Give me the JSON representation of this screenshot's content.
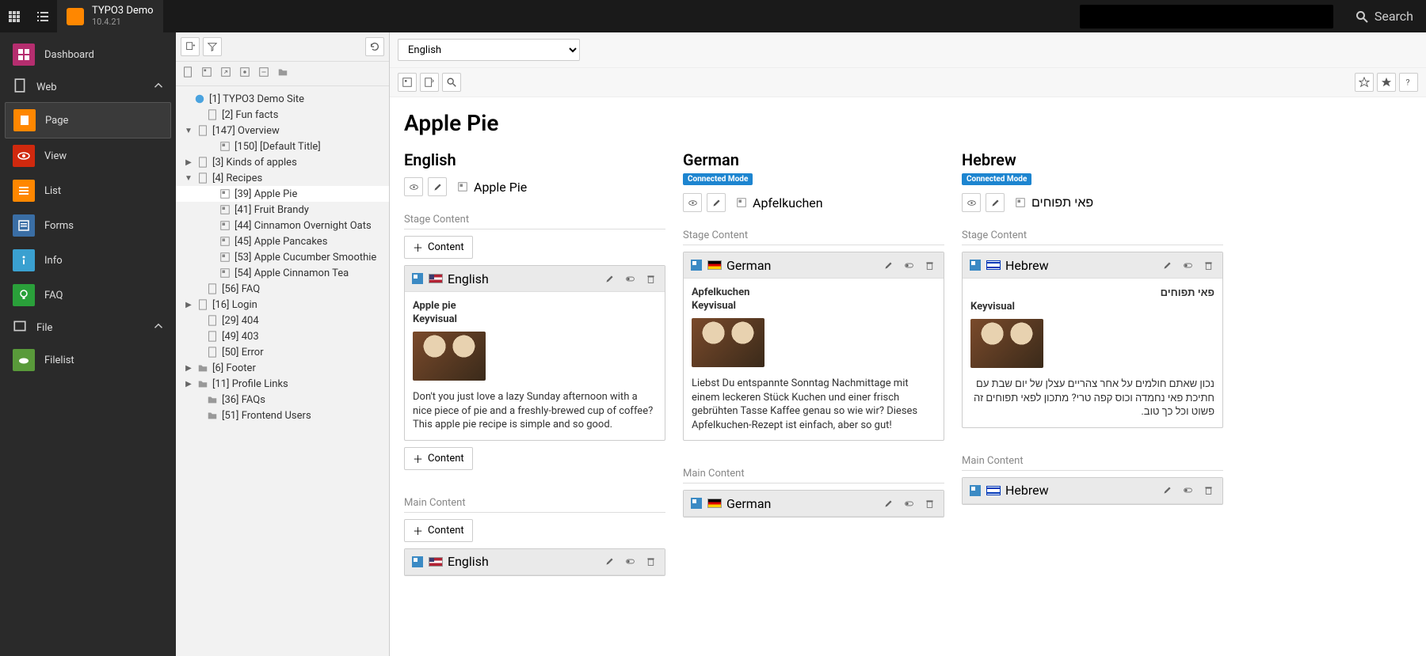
{
  "topbar": {
    "app_title": "TYPO3 Demo",
    "version": "10.4.21",
    "search_label": "Search"
  },
  "module_menu": {
    "dashboard": "Dashboard",
    "groups": {
      "web": "Web",
      "file": "File"
    },
    "web_items": {
      "page": "Page",
      "view": "View",
      "list": "List",
      "forms": "Forms",
      "info": "Info",
      "faq": "FAQ"
    },
    "file_items": {
      "filelist": "Filelist"
    }
  },
  "tree": {
    "root": "[1] TYPO3 Demo Site",
    "n2": "[2] Fun facts",
    "n147": "[147] Overview",
    "n150": "[150] [Default Title]",
    "n3": "[3] Kinds of apples",
    "n4": "[4] Recipes",
    "n39": "[39] Apple Pie",
    "n41": "[41] Fruit Brandy",
    "n44": "[44] Cinnamon Overnight Oats",
    "n45": "[45] Apple Pancakes",
    "n53": "[53] Apple Cucumber Smoothie",
    "n54": "[54] Apple Cinnamon Tea",
    "n56": "[56] FAQ",
    "n16": "[16] Login",
    "n29": "[29] 404",
    "n49": "[49] 403",
    "n50": "[50] Error",
    "n6": "[6] Footer",
    "n11": "[11] Profile Links",
    "n36": "[36] FAQs",
    "n51": "[51] Frontend Users"
  },
  "content": {
    "language_selector": "English",
    "page_title": "Apple Pie",
    "buttons": {
      "content": "Content"
    },
    "sections": {
      "stage": "Stage Content",
      "main": "Main Content"
    },
    "badge_connected": "Connected Mode",
    "cols": {
      "en": {
        "lang": "English",
        "page_label": "Apple Pie",
        "ce1_lang": "English",
        "ce1_title": "Apple pie",
        "ce1_sub": "Keyvisual",
        "ce1_desc": "Don't you just love a lazy Sunday afternoon with a nice piece of pie and a freshly-brewed cup of coffee?\nThis apple pie recipe is simple and so good.",
        "ce2_lang": "English"
      },
      "de": {
        "lang": "German",
        "page_label": "Apfelkuchen",
        "ce1_lang": "German",
        "ce1_title": "Apfelkuchen",
        "ce1_sub": "Keyvisual",
        "ce1_desc": "Liebst Du entspannte Sonntag Nachmittage mit einem leckeren Stück Kuchen und einer frisch gebrühten Tasse Kaffee genau so wie wir? Dieses Apfelkuchen-Rezept ist einfach, aber so gut!",
        "ce2_lang": "German"
      },
      "he": {
        "lang": "Hebrew",
        "page_label": "פאי תפוחים",
        "ce1_lang": "Hebrew",
        "ce1_title": "פאי תפוחים",
        "ce1_sub": "Keyvisual",
        "ce1_desc": "נכון שאתם חולמים על אחר צהריים עצלן של יום שבת עם חתיכת פאי נחמדה וכוס קפה טרי? מתכון לפאי תפוחים זה פשוט וכל כך טוב.",
        "ce2_lang": "Hebrew"
      }
    }
  }
}
